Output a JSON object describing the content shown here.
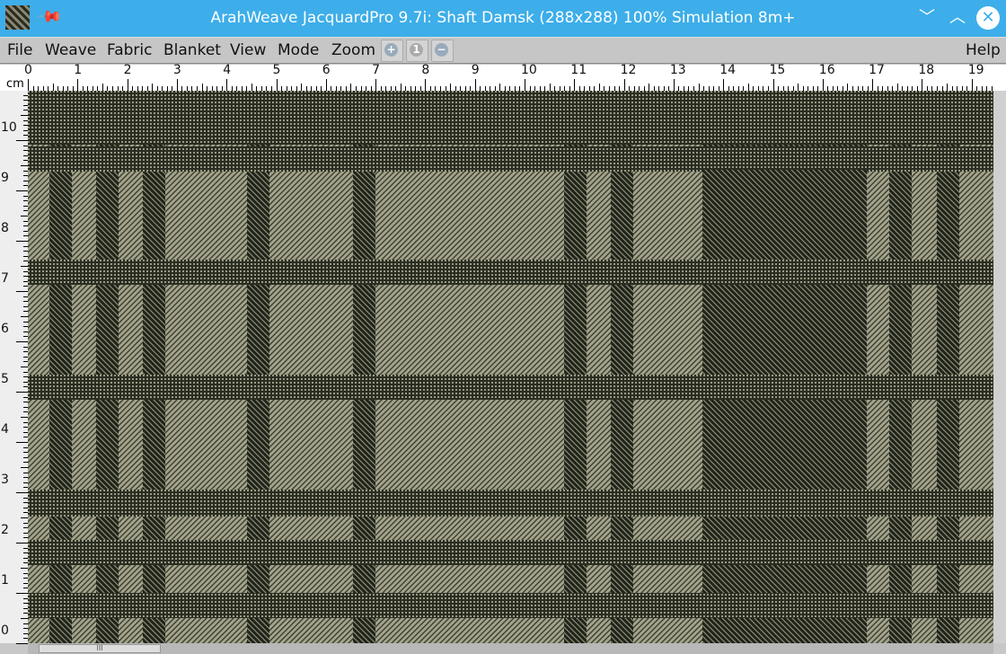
{
  "window": {
    "title": "ArahWeave JacquardPro 9.7i: Shaft Damsk (288x288) 100% Simulation 8m+",
    "icons": [
      "app-fabric-icon",
      "pin-icon",
      "minimize-icon",
      "maximize-icon",
      "close-icon"
    ]
  },
  "menu": {
    "items": [
      "File",
      "Weave",
      "Fabric",
      "Blanket",
      "View",
      "Mode",
      "Zoom"
    ],
    "help": "Help",
    "zoom_buttons": [
      "zoom-in-icon",
      "zoom-reset-icon",
      "zoom-out-icon"
    ],
    "zoom_reset_label": "1"
  },
  "ruler": {
    "unit": "cm",
    "h_labels": [
      "0",
      "1",
      "2",
      "3",
      "4",
      "5",
      "6",
      "7",
      "8",
      "9",
      "10",
      "11",
      "12",
      "13",
      "14",
      "15",
      "16",
      "17",
      "18",
      "19"
    ],
    "v_labels": [
      "0",
      "1",
      "2",
      "3",
      "4",
      "5",
      "6",
      "7",
      "8",
      "9",
      "10"
    ]
  },
  "colors": {
    "warp_light": "#a8a890",
    "weft_dark": "#1e2218",
    "accent": "#3daee9"
  },
  "scrollbar": {
    "grip": "III"
  }
}
